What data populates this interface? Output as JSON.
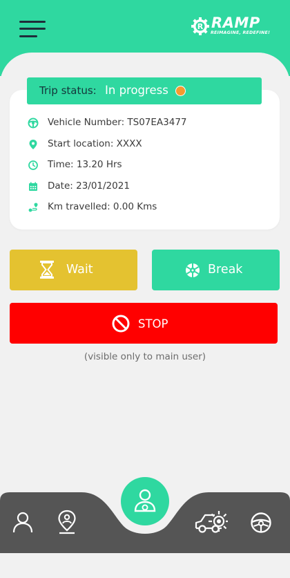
{
  "app": {
    "brand": "RAMP",
    "tagline": "REIMAGINE, REDEFINE!"
  },
  "trip": {
    "status_label": "Trip status:",
    "status_value": "In progress",
    "status_color": "#f59a2f",
    "vehicle": "Vehicle Number: TS07EA3477",
    "start_location": "Start location: XXXX",
    "time": "Time: 13.20 Hrs",
    "date": "Date: 23/01/2021",
    "km": "Km travelled: 0.00 Kms"
  },
  "actions": {
    "wait": "Wait",
    "break": "Break",
    "stop": "STOP"
  },
  "note": "(visible only to main user)",
  "icons": {
    "menu": "hamburger-icon",
    "vehicle": "steering-wheel-icon",
    "location": "location-pin-icon",
    "time": "clock-icon",
    "date": "calendar-icon",
    "km": "route-icon",
    "wait": "hourglass-icon",
    "break": "tire-icon",
    "stop": "prohibited-icon",
    "nav": [
      "person-icon",
      "location-icon",
      "driver-icon",
      "car-gear-icon",
      "steering-wheel-icon"
    ]
  },
  "colors": {
    "accent": "#2fd8a0",
    "wait": "#e4c230",
    "stop": "#ff0000",
    "nav": "#555555"
  }
}
